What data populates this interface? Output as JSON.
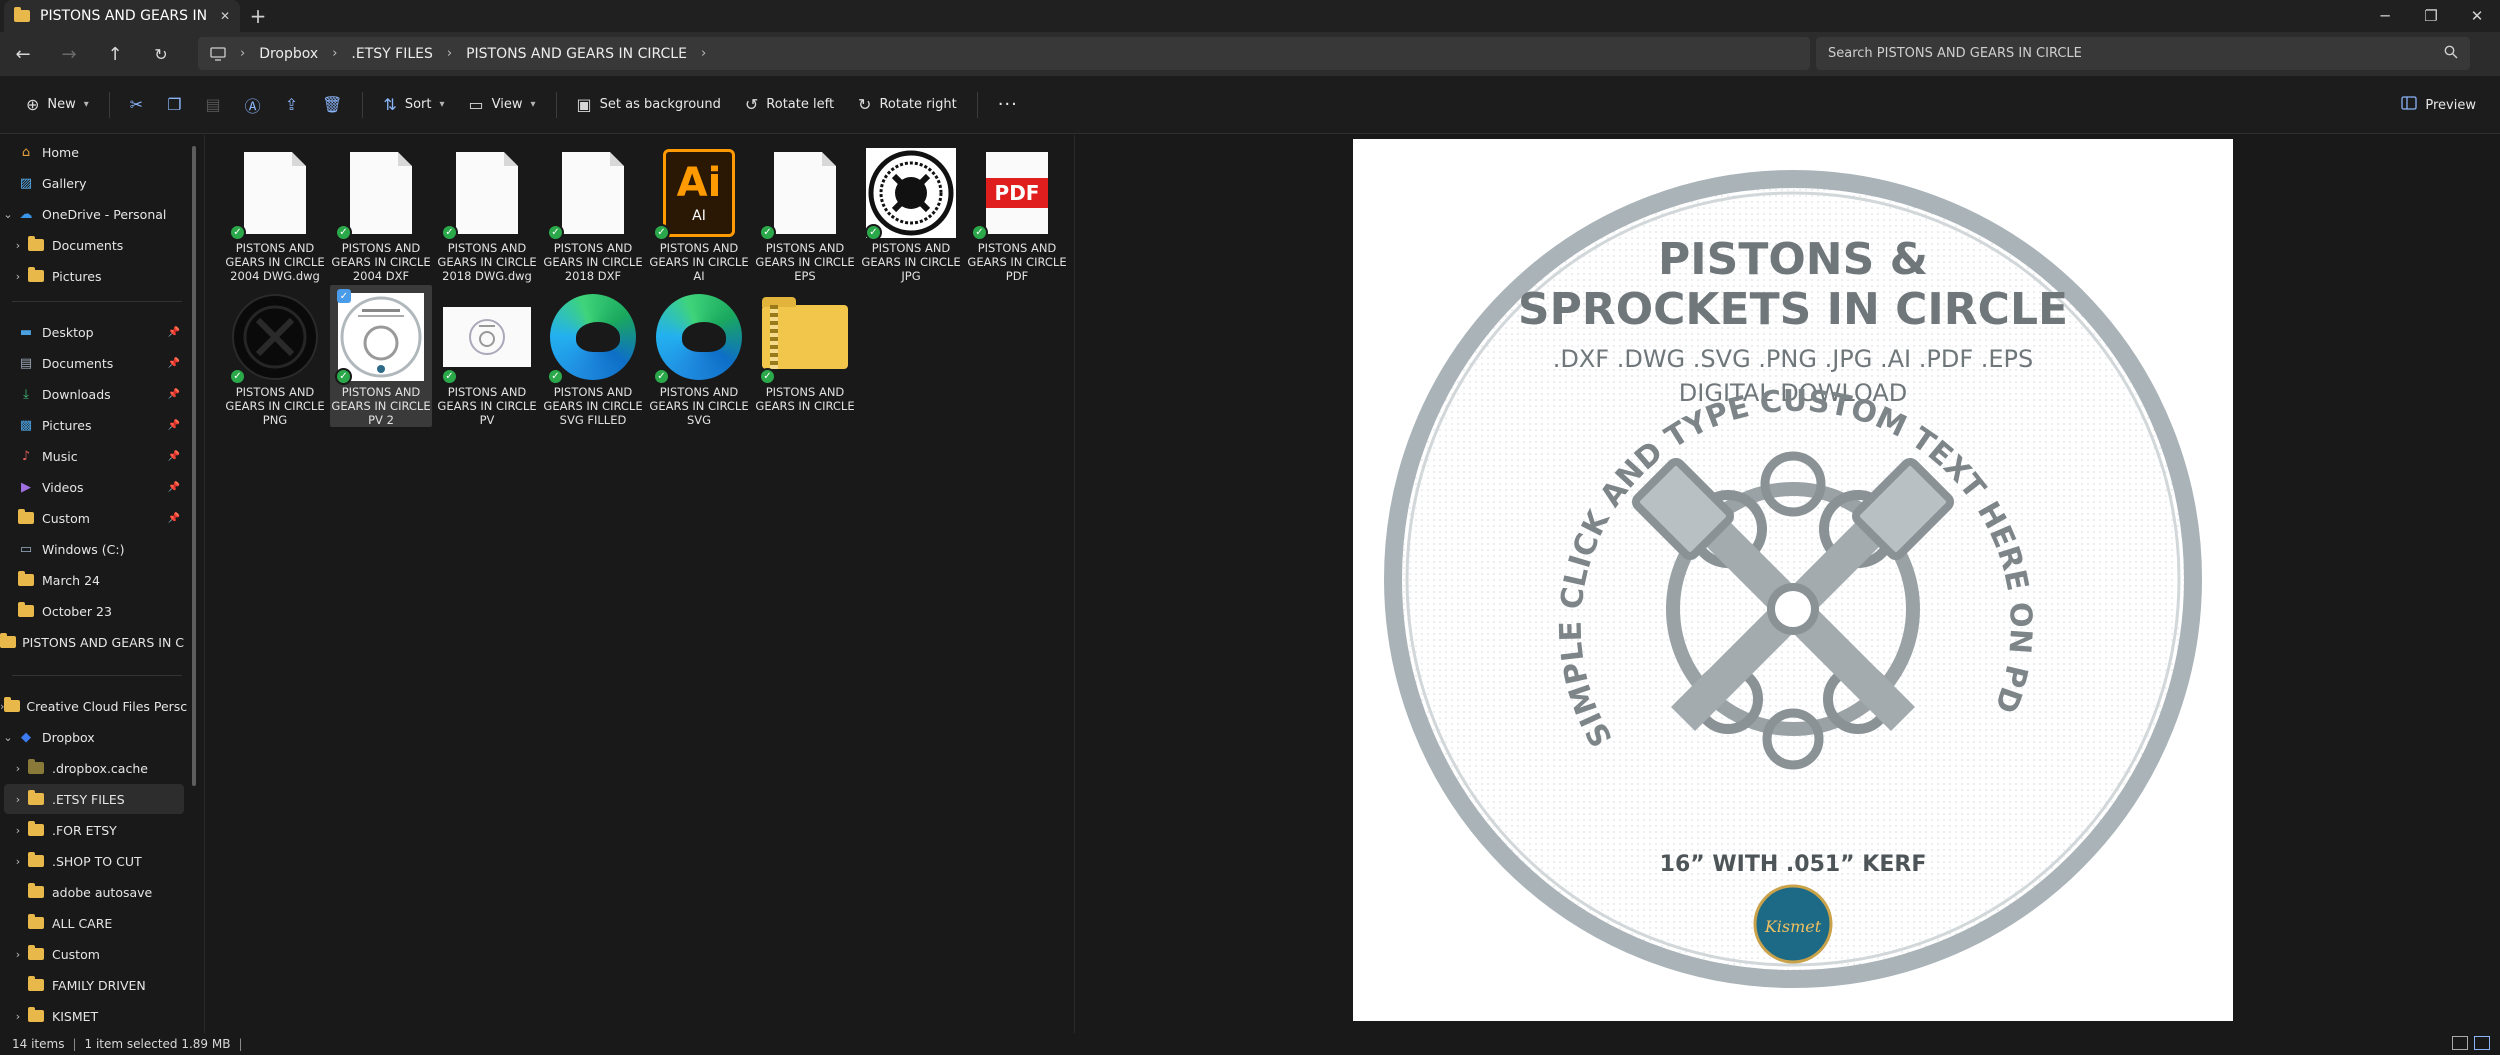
{
  "window": {
    "tab_title": "PISTONS AND GEARS IN CIRCLE",
    "new_tab": "+",
    "minimize": "─",
    "maximize": "❐",
    "close": "✕",
    "tab_close": "✕"
  },
  "address": {
    "crumbs": [
      "Dropbox",
      ".ETSY FILES",
      "PISTONS AND GEARS IN CIRCLE"
    ],
    "search_placeholder": "Search PISTONS AND GEARS IN CIRCLE"
  },
  "toolbar": {
    "new_label": "New",
    "sort_label": "Sort",
    "view_label": "View",
    "set_bg_label": "Set as background",
    "rotate_left_label": "Rotate left",
    "rotate_right_label": "Rotate right",
    "more_label": "···",
    "preview_label": "Preview"
  },
  "sidebar": {
    "items": [
      {
        "label": "Home",
        "icon": "home-icon"
      },
      {
        "label": "Gallery",
        "icon": "gallery-icon"
      },
      {
        "label": "OneDrive - Personal",
        "icon": "cloud-icon"
      },
      {
        "label": "Documents",
        "icon": "folder-icon"
      },
      {
        "label": "Pictures",
        "icon": "folder-icon"
      },
      {
        "label": "Desktop",
        "icon": "desktop-icon"
      },
      {
        "label": "Documents",
        "icon": "documents-icon"
      },
      {
        "label": "Downloads",
        "icon": "downloads-icon"
      },
      {
        "label": "Pictures",
        "icon": "pictures-icon"
      },
      {
        "label": "Music",
        "icon": "music-icon"
      },
      {
        "label": "Videos",
        "icon": "videos-icon"
      },
      {
        "label": "Custom",
        "icon": "folder-icon"
      },
      {
        "label": "Windows (C:)",
        "icon": "drive-icon"
      },
      {
        "label": "March 24",
        "icon": "folder-icon"
      },
      {
        "label": "October 23",
        "icon": "folder-icon"
      },
      {
        "label": "PISTONS AND GEARS IN C",
        "icon": "folder-icon"
      },
      {
        "label": "Creative Cloud Files Persc",
        "icon": "folder-icon"
      },
      {
        "label": "Dropbox",
        "icon": "dropbox-icon"
      },
      {
        "label": ".dropbox.cache",
        "icon": "folder-icon"
      },
      {
        "label": ".ETSY FILES",
        "icon": "folder-icon"
      },
      {
        "label": ".FOR ETSY",
        "icon": "folder-icon"
      },
      {
        "label": ".SHOP TO CUT",
        "icon": "folder-icon"
      },
      {
        "label": "adobe autosave",
        "icon": "folder-icon"
      },
      {
        "label": "ALL CARE",
        "icon": "folder-icon"
      },
      {
        "label": "Custom",
        "icon": "folder-icon"
      },
      {
        "label": "FAMILY DRIVEN",
        "icon": "folder-icon"
      },
      {
        "label": "KISMET",
        "icon": "folder-icon"
      }
    ]
  },
  "files": [
    {
      "name": "PISTONS AND GEARS IN CIRCLE 2004 DWG.dwg",
      "type": "doc"
    },
    {
      "name": "PISTONS AND GEARS IN CIRCLE 2004 DXF",
      "type": "doc"
    },
    {
      "name": "PISTONS AND GEARS IN CIRCLE 2018 DWG.dwg",
      "type": "doc"
    },
    {
      "name": "PISTONS AND GEARS IN CIRCLE 2018 DXF",
      "type": "doc"
    },
    {
      "name": "PISTONS AND GEARS IN CIRCLE AI",
      "type": "ai",
      "icon_big": "Ai",
      "icon_small": "AI"
    },
    {
      "name": "PISTONS AND GEARS IN CIRCLE EPS",
      "type": "doc"
    },
    {
      "name": "PISTONS AND GEARS IN CIRCLE JPG",
      "type": "image-white"
    },
    {
      "name": "PISTONS AND GEARS IN CIRCLE PDF",
      "type": "pdf",
      "icon_text": "PDF"
    },
    {
      "name": "PISTONS AND GEARS IN CIRCLE PNG",
      "type": "image-black"
    },
    {
      "name": "PISTONS AND GEARS IN CIRCLE PV 2",
      "type": "image-pv"
    },
    {
      "name": "PISTONS AND GEARS IN CIRCLE PV",
      "type": "image-landscape"
    },
    {
      "name": "PISTONS AND GEARS IN CIRCLE SVG FILLED",
      "type": "edge"
    },
    {
      "name": "PISTONS AND GEARS IN CIRCLE SVG",
      "type": "edge"
    },
    {
      "name": "PISTONS AND GEARS IN CIRCLE",
      "type": "zip"
    }
  ],
  "preview": {
    "title_line1": "PISTONS &",
    "title_line2": "SPROCKETS IN CIRCLE",
    "formats": ".DXF .DWG .SVG .PNG .JPG .AI .PDF .EPS",
    "download": "DIGITAL DOWLOAD",
    "arc_text": "SIMPLE CLICK AND TYPE CUSTOM TEXT HERE ON PDF AI AND EPS FILES",
    "size": "16” WITH .051” KERF",
    "logo": "Kismet",
    "ring_color": "#a9b3b8",
    "text_color": "#6f777b"
  },
  "status": {
    "count": "14 items",
    "selection": "1 item selected  1.89 MB"
  }
}
